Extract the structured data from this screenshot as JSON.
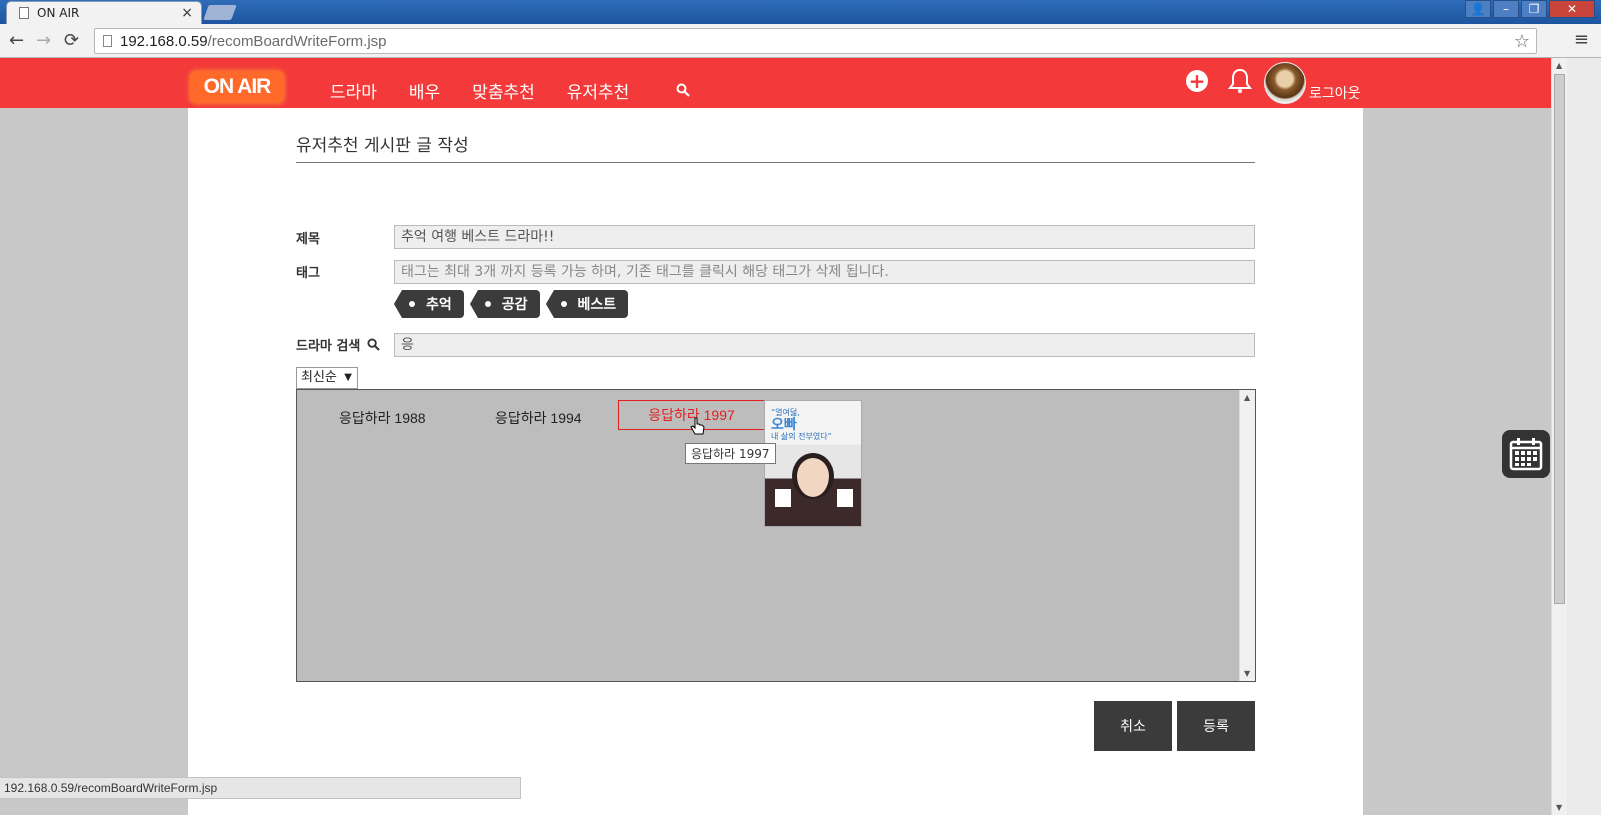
{
  "browser": {
    "tab_title": "ON AIR",
    "tab_close": "×",
    "url_host": "192.168.0.59",
    "url_path": "/recomBoardWriteForm.jsp",
    "back": "←",
    "forward": "→",
    "reload": "⟳",
    "star": "☆",
    "menu": "≡",
    "win_user": "👤",
    "win_min": "–",
    "win_max": "❐",
    "win_close": "✕"
  },
  "header": {
    "logo": "ON AIR",
    "nav": [
      "드라마",
      "배우",
      "맞춤추천",
      "유저추천"
    ],
    "logout": "로그아웃",
    "plus": "+"
  },
  "form": {
    "page_title": "유저추천 게시판 글 작성",
    "title_label": "제목",
    "title_value": "추억 여행 베스트 드라마!!",
    "tag_label": "태그",
    "tag_placeholder": "태그는 최대 3개 까지 등록 가능 하며, 기존 태그를 클릭시 해당 태그가 삭제 됩니다.",
    "tags": [
      "추억",
      "공감",
      "베스트"
    ],
    "drama_search_label": "드라마 검색",
    "drama_search_value": "응",
    "sort_selected": "최신순",
    "sort_arrow": "▼"
  },
  "results": {
    "items": [
      "응답하라 1988",
      "응답하라 1994",
      "응답하라 1997"
    ],
    "selected_index": 2,
    "tooltip": "응답하라 1997",
    "poster_copy_line1": "“열여덟,",
    "poster_copy_big": "오빠",
    "poster_copy_line3": "내 삶의 전부였다”",
    "scroll_up": "▲",
    "scroll_down": "▼"
  },
  "buttons": {
    "cancel": "취소",
    "submit": "등록"
  },
  "status_bar": "192.168.0.59/recomBoardWriteForm.jsp",
  "colors": {
    "header_red": "#f33939",
    "logo_orange": "#ff6a2a",
    "dark_button": "#3b3b3b",
    "selected_red": "#e21f1f"
  },
  "icons": {
    "search": "search-icon",
    "bell": "bell-icon",
    "plus": "plus-circle-icon",
    "calendar": "calendar-icon"
  }
}
